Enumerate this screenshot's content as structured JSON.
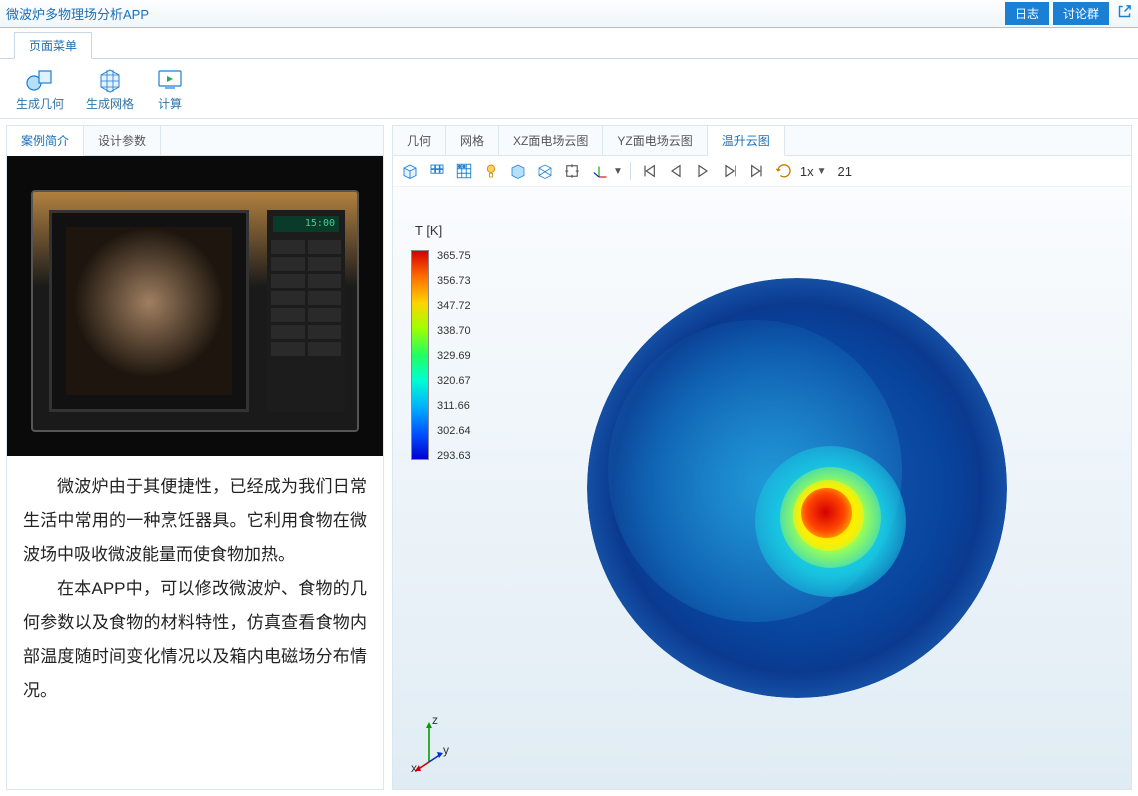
{
  "header": {
    "title": "微波炉多物理场分析APP",
    "log_btn": "日志",
    "discuss_btn": "讨论群"
  },
  "menubar": {
    "page_menu": "页面菜单"
  },
  "ribbon": {
    "gen_geom": "生成几何",
    "gen_mesh": "生成网格",
    "compute": "计算"
  },
  "left_tabs": {
    "case_intro": "案例简介",
    "design_params": "设计参数"
  },
  "microwave_display": "15:00",
  "case_text": {
    "p1": "微波炉由于其便捷性，已经成为我们日常生活中常用的一种烹饪器具。它利用食物在微波场中吸收微波能量而使食物加热。",
    "p2": "在本APP中，可以修改微波炉、食物的几何参数以及食物的材料特性，仿真查看食物内部温度随时间变化情况以及箱内电磁场分布情况。"
  },
  "right_tabs": {
    "geom": "几何",
    "mesh": "网格",
    "xz_field": "XZ面电场云图",
    "yz_field": "YZ面电场云图",
    "temp_rise": "温升云图"
  },
  "toolbar": {
    "speed": "1x",
    "frame": "21"
  },
  "legend": {
    "title": "T [K]",
    "labels": [
      "365.75",
      "356.73",
      "347.72",
      "338.70",
      "329.69",
      "320.67",
      "311.66",
      "302.64",
      "293.63"
    ]
  },
  "axes": {
    "x": "x",
    "y": "y",
    "z": "z"
  }
}
